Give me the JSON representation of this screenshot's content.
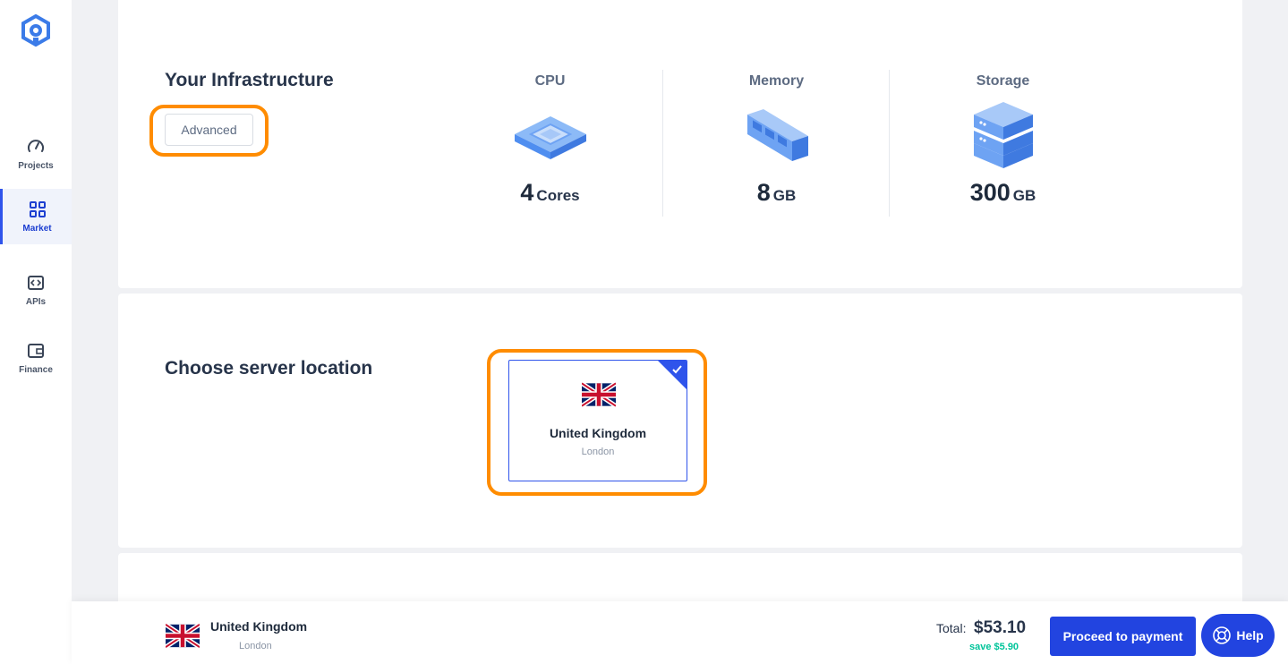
{
  "sidebar": {
    "items": [
      {
        "label": "Projects",
        "icon": "gauge-icon"
      },
      {
        "label": "Market",
        "icon": "grid-icon",
        "active": true
      },
      {
        "label": "APIs",
        "icon": "code-icon"
      },
      {
        "label": "Finance",
        "icon": "wallet-icon"
      }
    ]
  },
  "infrastructure": {
    "title": "Your Infrastructure",
    "advanced_label": "Advanced",
    "specs": [
      {
        "title": "CPU",
        "value": "4",
        "unit": "Cores",
        "icon": "cpu-icon"
      },
      {
        "title": "Memory",
        "value": "8",
        "unit": "GB",
        "icon": "memory-icon"
      },
      {
        "title": "Storage",
        "value": "300",
        "unit": "GB",
        "icon": "storage-icon"
      }
    ]
  },
  "location": {
    "title": "Choose server location",
    "selected": {
      "country": "United Kingdom",
      "city": "London"
    }
  },
  "summary": {
    "country": "United Kingdom",
    "city": "London",
    "total_label": "Total:",
    "total_value": "$53.10",
    "save_text": "save $5.90",
    "pay_label": "Proceed to payment",
    "help_label": "Help"
  },
  "colors": {
    "accent": "#2244e0",
    "highlight_outline": "#ff8c00",
    "savings": "#00c49a"
  }
}
